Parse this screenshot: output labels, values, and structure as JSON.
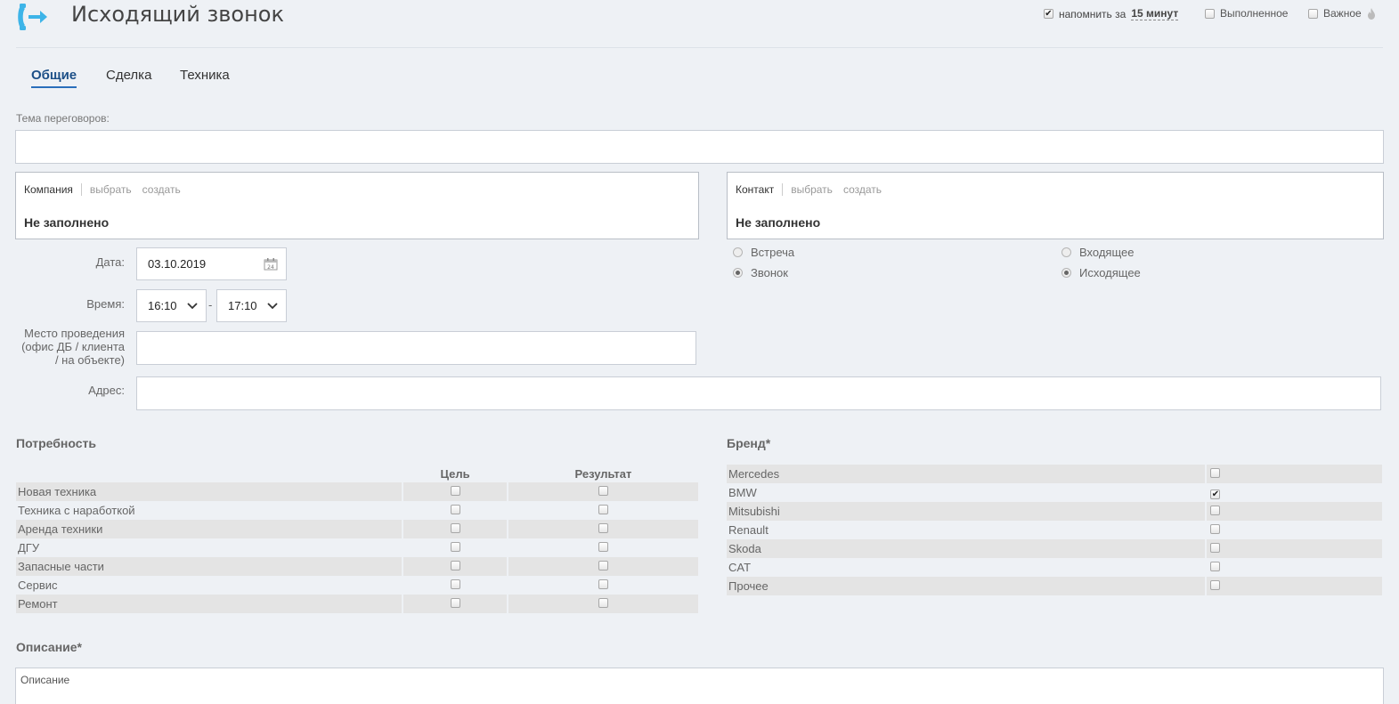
{
  "header": {
    "title": "Исходящий звонок",
    "remind_label": "напомнить за",
    "remind_value": "15 минут",
    "remind_checked": true,
    "done_label": "Выполненное",
    "important_label": "Важное"
  },
  "tabs": [
    {
      "label": "Общие",
      "active": true
    },
    {
      "label": "Сделка",
      "active": false
    },
    {
      "label": "Техника",
      "active": false
    }
  ],
  "subject": {
    "label": "Тема переговоров:",
    "value": ""
  },
  "company": {
    "label": "Компания",
    "select": "выбрать",
    "create": "создать",
    "value": "Не заполнено"
  },
  "contact": {
    "label": "Контакт",
    "select": "выбрать",
    "create": "создать",
    "value": "Не заполнено"
  },
  "date": {
    "label": "Дата:",
    "value": "03.10.2019"
  },
  "time": {
    "label": "Время:",
    "from": "16:10",
    "dash": "-",
    "to": "17:10"
  },
  "place": {
    "label": "Место проведения (офис ДБ / клиента / на объекте)",
    "value": ""
  },
  "address": {
    "label": "Адрес:",
    "value": ""
  },
  "type_radios": [
    {
      "label": "Встреча",
      "checked": false
    },
    {
      "label": "Звонок",
      "checked": true
    }
  ],
  "direction_radios": [
    {
      "label": "Входящее",
      "checked": false
    },
    {
      "label": "Исходящее",
      "checked": true
    }
  ],
  "need": {
    "title": "Потребность",
    "col_goal": "Цель",
    "col_result": "Результат",
    "rows": [
      "Новая техника",
      "Техника с наработкой",
      "Аренда техники",
      "ДГУ",
      "Запасные части",
      "Сервис",
      "Ремонт"
    ]
  },
  "brand": {
    "title": "Бренд*",
    "rows": [
      {
        "label": "Mercedes",
        "checked": false
      },
      {
        "label": "BMW",
        "checked": true
      },
      {
        "label": "Mitsubishi",
        "checked": false
      },
      {
        "label": "Renault",
        "checked": false
      },
      {
        "label": "Skoda",
        "checked": false
      },
      {
        "label": "CAT",
        "checked": false
      },
      {
        "label": "Прочее",
        "checked": false
      }
    ]
  },
  "description": {
    "title": "Описание*",
    "placeholder": "Описание"
  },
  "colors": {
    "accent": "#2a6ebb",
    "icon": "#3db4e8"
  }
}
